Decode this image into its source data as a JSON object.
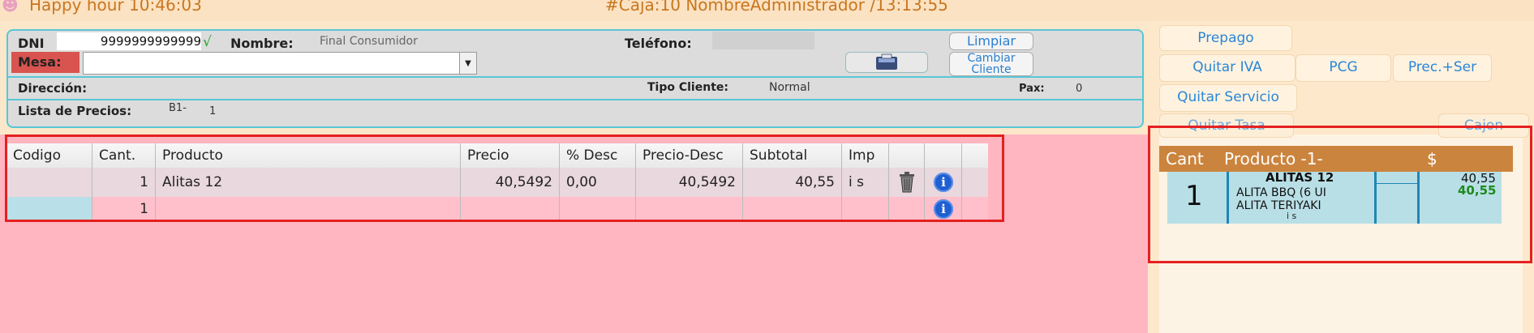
{
  "topbar": {
    "left": "Happy hour  10:46:03",
    "center": "#Caja:10  NombreAdministrador  /13:13:55"
  },
  "form": {
    "dni_label": "DNI",
    "dni_value": "9999999999999",
    "check_mark": "√",
    "nombre_label": "Nombre:",
    "nombre_value": "Final Consumidor",
    "telefono_label": "Teléfono:",
    "telefono_value": "",
    "mesa_label": "Mesa:",
    "mesa_value": "",
    "limpiar_label": "Limpiar",
    "cambiar_cliente_label": "Cambiar Cliente",
    "direccion_label": "Dirección:",
    "tipo_cliente_label": "Tipo Cliente:",
    "tipo_cliente_value": "Normal",
    "pax_label": "Pax:",
    "pax_value": "0",
    "lista_precios_label": "Lista de Precios:",
    "lista_precios_code": "B1-",
    "lista_precios_value": "1"
  },
  "grid": {
    "columns": [
      "Codigo",
      "Cant.",
      "Producto",
      "Precio",
      "% Desc",
      "Precio-Desc",
      "Subtotal",
      "Imp",
      "",
      ""
    ],
    "rows": [
      {
        "codigo": "",
        "cant": "1",
        "producto": "Alitas 12",
        "precio": "40,5492",
        "desc": "0,00",
        "precio_desc": "40,5492",
        "subtotal": "40,55",
        "imp": "i s"
      },
      {
        "codigo": "",
        "cant": "1",
        "producto": "",
        "precio": "",
        "desc": "",
        "precio_desc": "",
        "subtotal": "",
        "imp": ""
      }
    ]
  },
  "right_panel": {
    "buttons": {
      "prepago": "Prepago",
      "quitar_iva": "Quitar IVA",
      "pcg": "PCG",
      "prec_ser": "Prec.+Ser",
      "quitar_servicio": "Quitar Servicio",
      "quitar_tasa": "Quitar Tasa",
      "cajon": "Cajon"
    },
    "order_header": {
      "cant": "Cant",
      "producto": "Producto   -1-",
      "precio": "$"
    },
    "order_items": [
      {
        "cant": "1",
        "title": "ALITAS 12",
        "line1": "ALITA BBQ (6 UI",
        "line2": "ALITA TERIYAKI",
        "imp": "i s",
        "price": "40,55",
        "price_total": "40,55"
      }
    ]
  },
  "icons": {
    "info": "info-icon",
    "trash": "trash-icon",
    "card": "card-reader-icon",
    "dropdown": "chevron-down-icon"
  }
}
